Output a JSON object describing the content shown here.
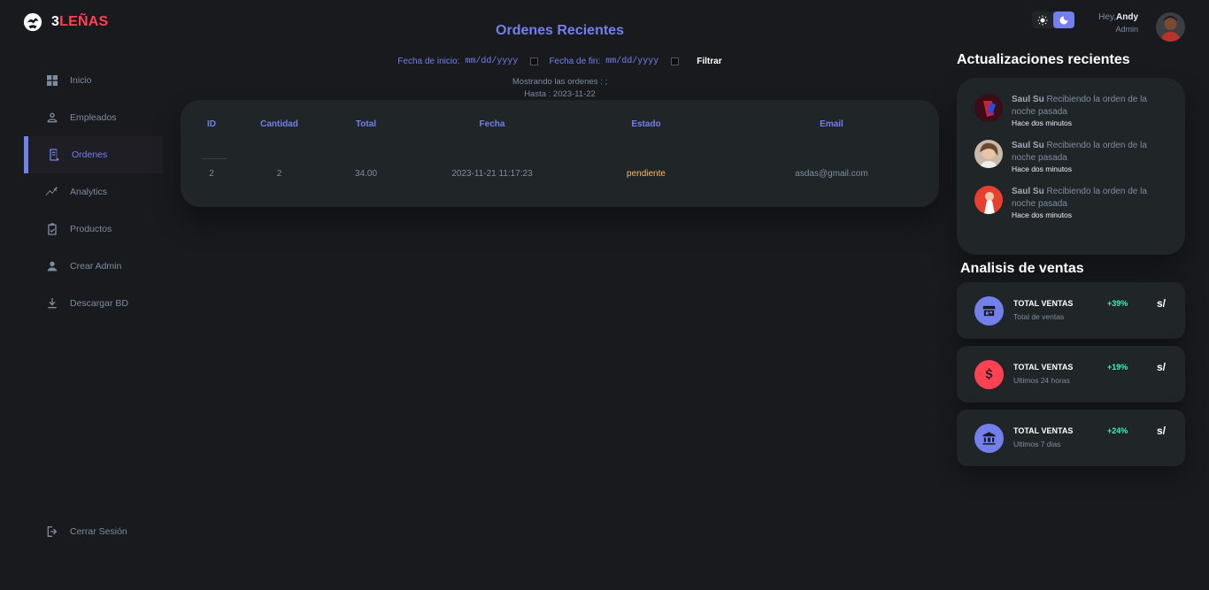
{
  "brand": {
    "part1": "3",
    "part2": "LEÑAS"
  },
  "sidebar": {
    "items": [
      {
        "label": "Inicio",
        "icon": "grid-icon"
      },
      {
        "label": "Empleados",
        "icon": "person-outline-icon"
      },
      {
        "label": "Ordenes",
        "icon": "receipt-icon",
        "active": true
      },
      {
        "label": "Analytics",
        "icon": "insights-icon"
      },
      {
        "label": "Productos",
        "icon": "clipboard-check-icon"
      },
      {
        "label": "Crear Admin",
        "icon": "person-icon"
      },
      {
        "label": "Descargar BD",
        "icon": "download-icon"
      }
    ],
    "logout": "Cerrar Sesión"
  },
  "main": {
    "title": "Ordenes Recientes",
    "filter": {
      "start_label": "Fecha de inicio:",
      "start_value": "mm/dd/yyyy",
      "end_label": "Fecha de fin:",
      "end_value": "mm/dd/yyyy",
      "button": "Filtrar"
    },
    "showing_line1": "Mostrando las ordenes : ;",
    "showing_line2": "Hasta : 2023-11-22",
    "table": {
      "headers": [
        "ID",
        "Cantidad",
        "Total",
        "Fecha",
        "Estado",
        "Email"
      ],
      "rows": [
        [
          "2",
          "2",
          "34.00",
          "2023-11-21 11:17:23",
          "pendiente",
          "asdas@gmail.com"
        ]
      ]
    }
  },
  "top": {
    "greeting": "Hey,",
    "user": "Andy",
    "role": "Admin"
  },
  "updates": {
    "title": "Actualizaciones recientes",
    "items": [
      {
        "name": "Saul Su",
        "text": "Recibiendo la orden de la noche pasada",
        "time": "Hace dos minutos"
      },
      {
        "name": "Saul Su",
        "text": "Recibiendo la orden de la noche pasada",
        "time": "Hace dos minutos"
      },
      {
        "name": "Saul Su",
        "text": "Recibiendo la orden de la noche pasada",
        "time": "Hace dos minutos"
      }
    ]
  },
  "sales": {
    "title": "Analisis de ventas",
    "items": [
      {
        "title": "TOTAL VENTAS",
        "sub": "Total de ventas",
        "pct": "+39%",
        "currency": "s/",
        "color": "#7380ec",
        "icon": "store-icon"
      },
      {
        "title": "TOTAL VENTAS",
        "sub": "Ultimos 24 horas",
        "pct": "+19%",
        "currency": "s/",
        "color": "#ff4154",
        "icon": "dollar-icon"
      },
      {
        "title": "TOTAL VENTAS",
        "sub": "Ultimos 7 dias",
        "pct": "+24%",
        "currency": "s/",
        "color": "#7380ec",
        "icon": "bank-icon"
      }
    ]
  },
  "colors": {
    "accent": "#7380ec",
    "danger": "#ff4154",
    "warning": "#ffbb55",
    "success": "#41f1b6",
    "background": "#181a1e",
    "card": "#202528"
  }
}
